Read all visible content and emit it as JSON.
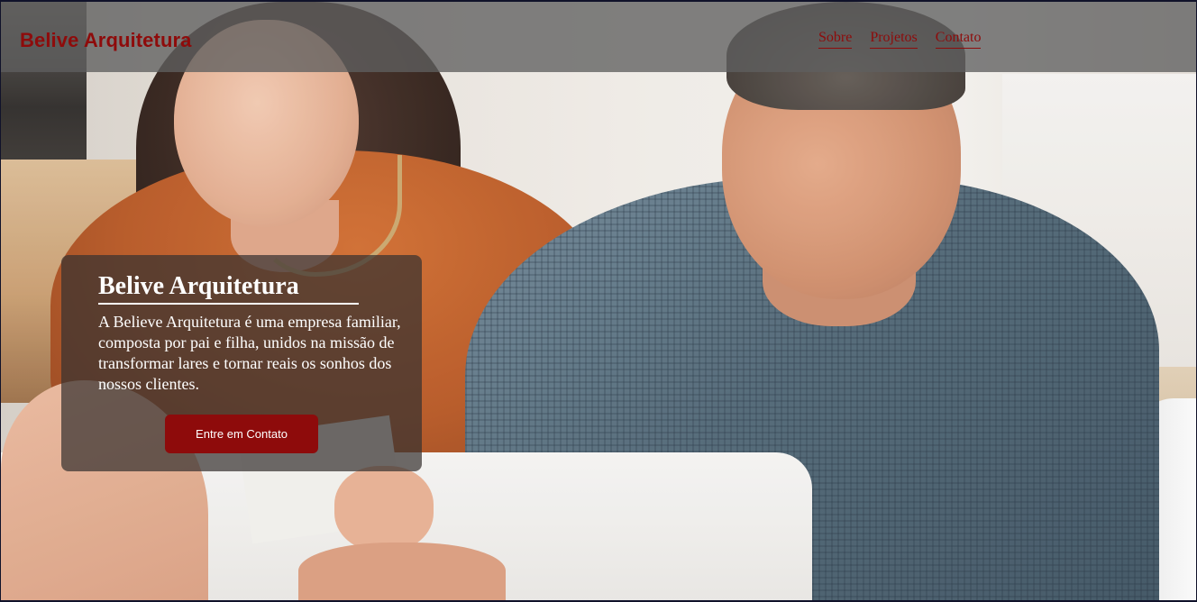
{
  "header": {
    "brand": "Belive Arquitetura",
    "nav": [
      {
        "label": "Sobre"
      },
      {
        "label": "Projetos"
      },
      {
        "label": "Contato"
      }
    ]
  },
  "hero": {
    "title": "Belive Arquitetura",
    "description": "A Believe Arquitetura é uma empresa familiar, composta por pai e filha, unidos na missão de transformar lares e tornar reais os sonhos dos nossos clientes.",
    "cta_label": "Entre em Contato"
  },
  "colors": {
    "brand_red": "#8e0b0b",
    "header_overlay": "#5f5f5f",
    "card_overlay": "#373230"
  }
}
